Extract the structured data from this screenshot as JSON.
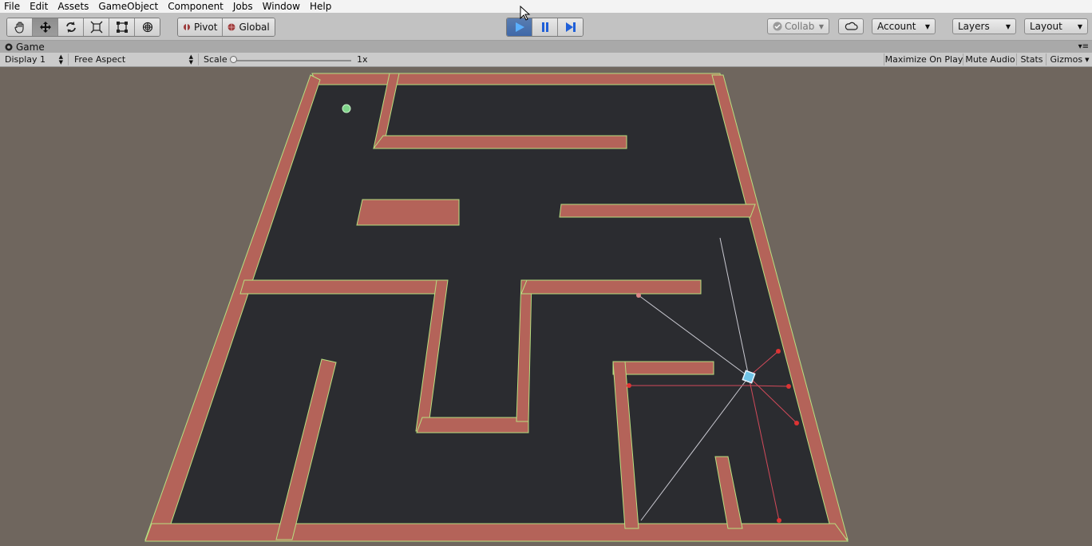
{
  "menubar": {
    "items": [
      "File",
      "Edit",
      "Assets",
      "GameObject",
      "Component",
      "Jobs",
      "Window",
      "Help"
    ]
  },
  "toolbar": {
    "tools": [
      "hand-tool-icon",
      "move-tool-icon",
      "rotate-tool-icon",
      "scale-tool-icon",
      "rect-tool-icon",
      "transform-tool-icon"
    ],
    "pivot_label": "Pivot",
    "global_label": "Global",
    "play_controls": [
      "play-icon",
      "pause-icon",
      "step-icon"
    ],
    "collab_label": "Collab",
    "account_label": "Account",
    "layers_label": "Layers",
    "layout_label": "Layout"
  },
  "game_tab": {
    "title": "Game"
  },
  "game_bar": {
    "display_label": "Display 1",
    "aspect_label": "Free Aspect",
    "scale_label": "Scale",
    "scale_value": "1x",
    "maximize_label": "Maximize On Play",
    "mute_label": "Mute Audio",
    "stats_label": "Stats",
    "gizmos_label": "Gizmos"
  },
  "colors": {
    "floor": "#2b2c30",
    "wall": "#b46359",
    "wall_outline": "#b7e080",
    "background": "#6f665e",
    "play_active": "#3f68a8"
  }
}
